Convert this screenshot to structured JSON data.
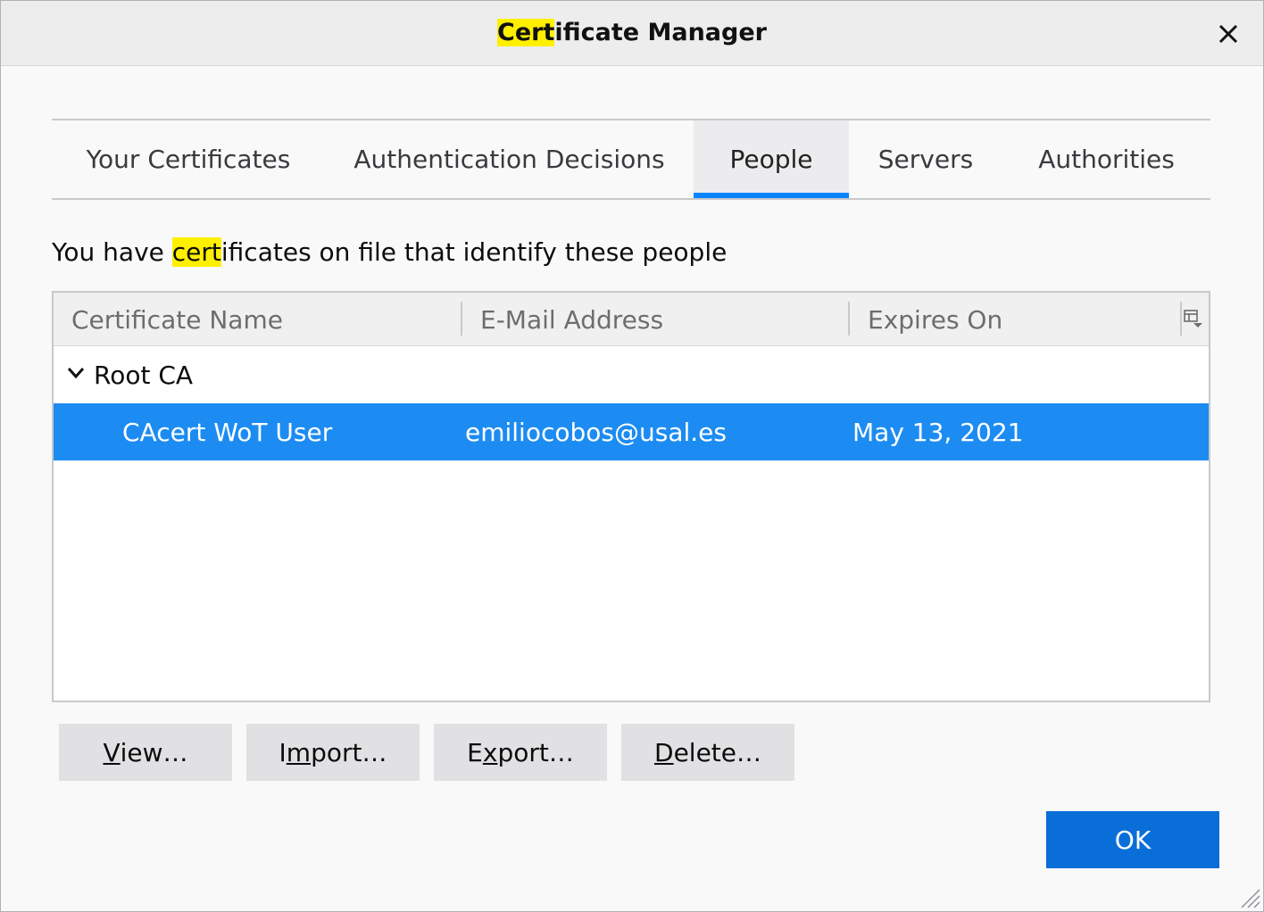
{
  "window": {
    "title_highlight": "Cert",
    "title_rest": "ificate Manager"
  },
  "tabs": [
    {
      "label": "Your Certificates"
    },
    {
      "label": "Authentication Decisions"
    },
    {
      "label": "People",
      "selected": true
    },
    {
      "label": "Servers"
    },
    {
      "label": "Authorities"
    }
  ],
  "description": {
    "before": "You have ",
    "highlight": "cert",
    "after": "ificates on file that identify these people"
  },
  "tree": {
    "columns": [
      "Certificate Name",
      "E-Mail Address",
      "Expires On"
    ],
    "group": {
      "name": "Root CA"
    },
    "rows": [
      {
        "name": "CAcert WoT User",
        "email": "emiliocobos@usal.es",
        "expires": "May 13, 2021",
        "selected": true
      }
    ]
  },
  "buttons": {
    "view": {
      "pre": "",
      "key": "V",
      "post": "iew…"
    },
    "import": {
      "pre": "I",
      "key": "m",
      "post": "port…"
    },
    "export": {
      "pre": "E",
      "key": "x",
      "post": "port…"
    },
    "delete": {
      "pre": "",
      "key": "D",
      "post": "elete…"
    },
    "ok": "OK"
  },
  "colors": {
    "accent": "#0a84ff",
    "selection": "#1c8cf2",
    "highlight": "#fff000",
    "ok_button": "#0a6ed9"
  },
  "icons": {
    "close": "close-icon",
    "twisty": "chevron-down-icon",
    "column_picker": "column-picker-icon",
    "resize": "resize-grip-icon"
  }
}
